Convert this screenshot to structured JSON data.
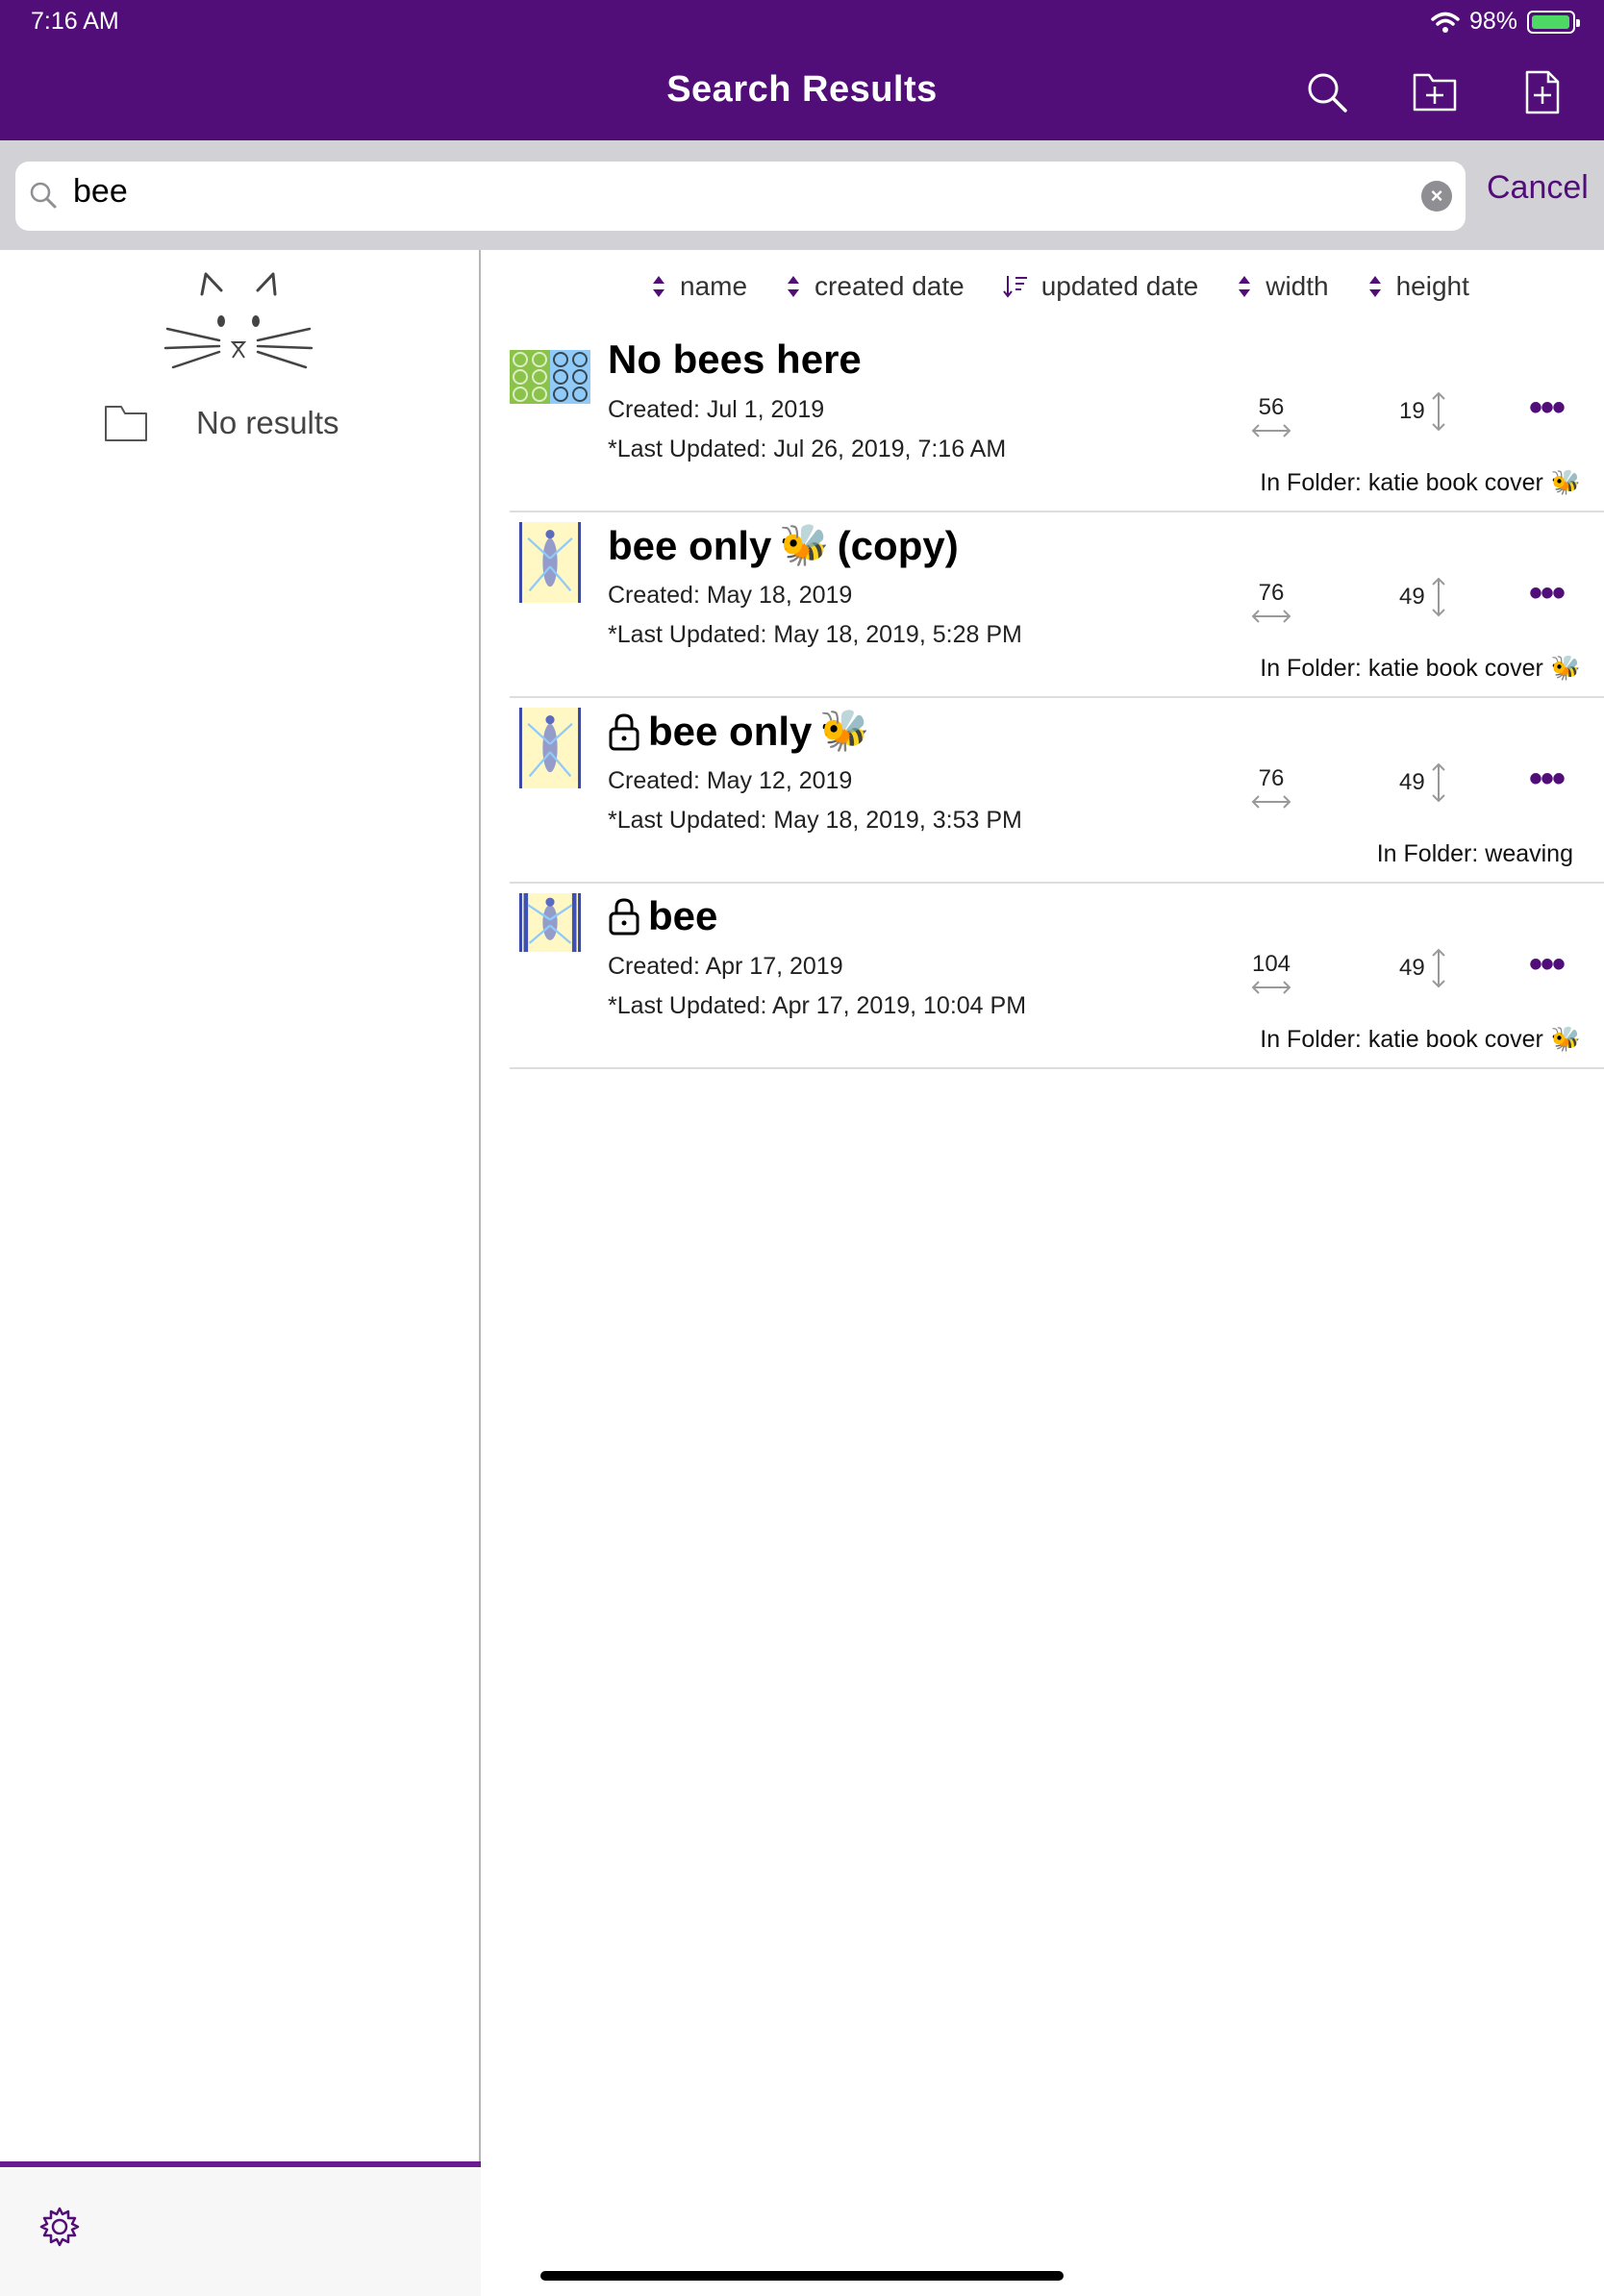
{
  "status": {
    "time": "7:16 AM",
    "battery": "98%",
    "battery_level": 0.98
  },
  "nav": {
    "title": "Search Results",
    "icons": [
      "search-icon",
      "add-folder-icon",
      "add-file-icon"
    ]
  },
  "search": {
    "value": "bee",
    "cancel_label": "Cancel"
  },
  "sidebar": {
    "empty_label": "No results"
  },
  "sort": {
    "options": [
      {
        "label": "name",
        "state": "none"
      },
      {
        "label": "created date",
        "state": "none"
      },
      {
        "label": "updated date",
        "state": "descending"
      },
      {
        "label": "width",
        "state": "none"
      },
      {
        "label": "height",
        "state": "none"
      }
    ]
  },
  "colors": {
    "brand": "#520e78",
    "accent": "#6a1b8f"
  },
  "results": [
    {
      "title": "No bees here",
      "title_emoji": "",
      "title_suffix": "",
      "locked": false,
      "created": "Created: Jul 1, 2019",
      "updated": "*Last Updated: Jul 26, 2019, 7:16 AM",
      "width": "56",
      "height": "19",
      "folder": "In Folder: katie book cover",
      "folder_emoji": "🐝",
      "thumb": "green-hexagon-pattern"
    },
    {
      "title": "bee only",
      "title_emoji": "🐝",
      "title_suffix": "(copy)",
      "locked": false,
      "created": "Created: May 18, 2019",
      "updated": "*Last Updated: May 18, 2019, 5:28 PM",
      "width": "76",
      "height": "49",
      "folder": "In Folder: katie book cover",
      "folder_emoji": "🐝",
      "thumb": "bee-pattern"
    },
    {
      "title": "bee only",
      "title_emoji": "🐝",
      "title_suffix": "",
      "locked": true,
      "created": "Created: May 12, 2019",
      "updated": "*Last Updated: May 18, 2019, 3:53 PM",
      "width": "76",
      "height": "49",
      "folder": "In Folder: weaving",
      "folder_emoji": "",
      "thumb": "bee-pattern"
    },
    {
      "title": "bee",
      "title_emoji": "",
      "title_suffix": "",
      "locked": true,
      "created": "Created: Apr 17, 2019",
      "updated": "*Last Updated: Apr 17, 2019, 10:04 PM",
      "width": "104",
      "height": "49",
      "folder": "In Folder: katie book cover",
      "folder_emoji": "🐝",
      "thumb": "bee-pattern-wide"
    }
  ]
}
